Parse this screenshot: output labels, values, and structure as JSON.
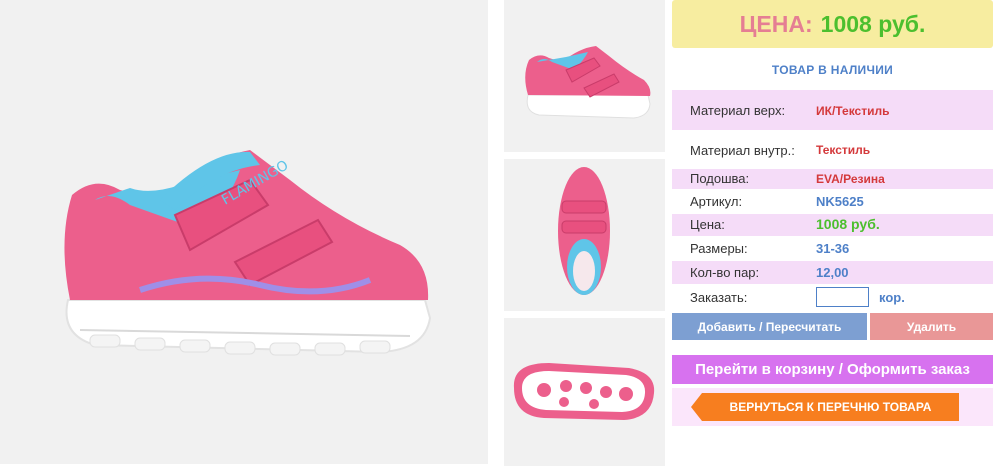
{
  "price": {
    "label": "ЦЕНА:",
    "value": "1008 руб."
  },
  "stock_status": "ТОВАР В НАЛИЧИИ",
  "specs": [
    {
      "key": "Материал верх:",
      "value": "ИК/Текстиль"
    },
    {
      "key": "Материал внутр.:",
      "value": "Текстиль"
    },
    {
      "key": "Подошва:",
      "value": "EVA/Резина"
    },
    {
      "key": "Артикул:",
      "value": "NK5625"
    },
    {
      "key": "Цена:",
      "value": "1008 руб."
    },
    {
      "key": "Размеры:",
      "value": "31-36"
    },
    {
      "key": "Кол-во пар:",
      "value": "12,00"
    }
  ],
  "order": {
    "label": "Заказать:",
    "value": "",
    "unit": "кор."
  },
  "buttons": {
    "add": "Добавить / Пересчитать",
    "delete": "Удалить",
    "cart": "Перейти в корзину / Оформить заказ",
    "back": "ВЕРНУТЬСЯ К ПЕРЕЧНЮ ТОВАРА"
  },
  "shoe_brand_text": "FLAMINGO",
  "colors": {
    "shoe_pink": "#ec5f8c",
    "shoe_accent": "#5fc5e8",
    "sole": "#ffffff",
    "price_bg": "#f7eda0",
    "green": "#4cbf2e",
    "blue": "#4e80c8",
    "orange": "#f77e1f",
    "purple": "#d772ef"
  }
}
